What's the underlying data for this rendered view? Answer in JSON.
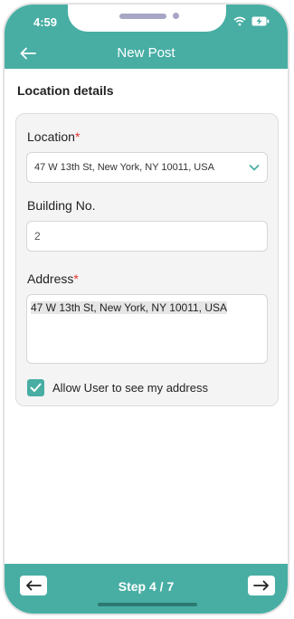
{
  "status_bar": {
    "time": "4:59"
  },
  "header": {
    "title": "New Post"
  },
  "section_title": "Location details",
  "form": {
    "location": {
      "label": "Location",
      "required_mark": "*",
      "value": "47 W 13th St, New York, NY 10011, USA"
    },
    "building": {
      "label": "Building No.",
      "value": "2"
    },
    "address": {
      "label": "Address",
      "required_mark": "*",
      "value": "47 W 13th St, New York, NY 10011, USA"
    },
    "allow_user": {
      "label": "Allow User to see my address",
      "checked": true
    }
  },
  "footer": {
    "step_text": "Step 4 / 7"
  },
  "colors": {
    "accent": "#48aea4",
    "required": "#e33232"
  },
  "icons": {
    "back": "arrow-left-icon",
    "dropdown": "chevron-down-icon",
    "checkbox": "check-icon",
    "prev": "arrow-left-icon",
    "next": "arrow-right-icon",
    "wifi": "wifi-icon",
    "battery": "battery-charging-icon"
  }
}
